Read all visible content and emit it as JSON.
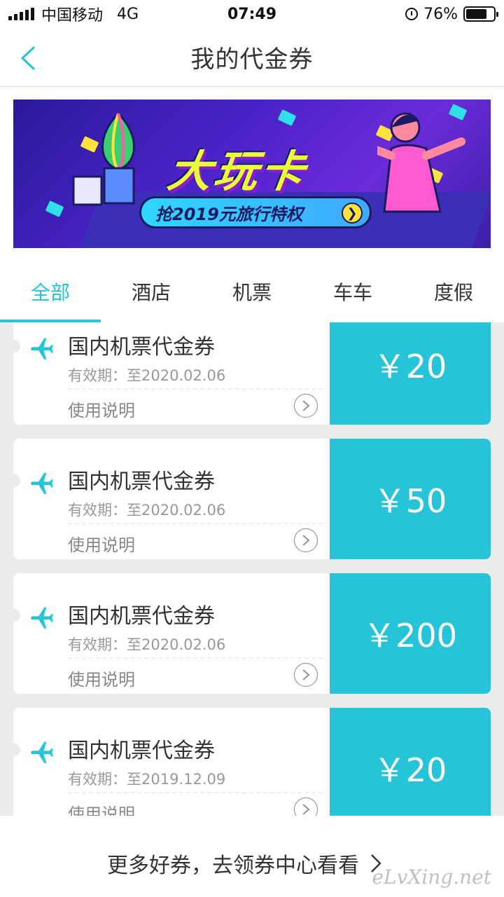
{
  "status_bar": {
    "carrier": "中国移动",
    "network": "4G",
    "time": "07:49",
    "battery_percent": "76%",
    "battery_level": 0.76
  },
  "header": {
    "title": "我的代金券"
  },
  "banner": {
    "headline": "大玩卡",
    "cta": "抢2019元旅行特权"
  },
  "tabs": [
    {
      "label": "全部",
      "active": true
    },
    {
      "label": "酒店",
      "active": false
    },
    {
      "label": "机票",
      "active": false
    },
    {
      "label": "车车",
      "active": false
    },
    {
      "label": "度假",
      "active": false
    }
  ],
  "coupons": [
    {
      "title": "国内机票代金券",
      "expiry": "有效期：至2020.02.06",
      "usage": "使用说明",
      "amount": "￥20"
    },
    {
      "title": "国内机票代金券",
      "expiry": "有效期：至2020.02.06",
      "usage": "使用说明",
      "amount": "￥50"
    },
    {
      "title": "国内机票代金券",
      "expiry": "有效期：至2020.02.06",
      "usage": "使用说明",
      "amount": "￥200"
    },
    {
      "title": "国内机票代金券",
      "expiry": "有效期：至2019.12.09",
      "usage": "使用说明",
      "amount": "￥20"
    }
  ],
  "footer": {
    "text": "更多好券，去领券中心看看"
  },
  "watermark": "eLvXing.net",
  "colors": {
    "accent": "#25c4d8",
    "list_background": "#ececec"
  },
  "icons": {
    "back": "chevron-left-icon",
    "coupon_type": "airplane-icon",
    "usage_arrow": "circle-chevron-right-icon",
    "footer_arrow": "chevron-right-icon"
  }
}
